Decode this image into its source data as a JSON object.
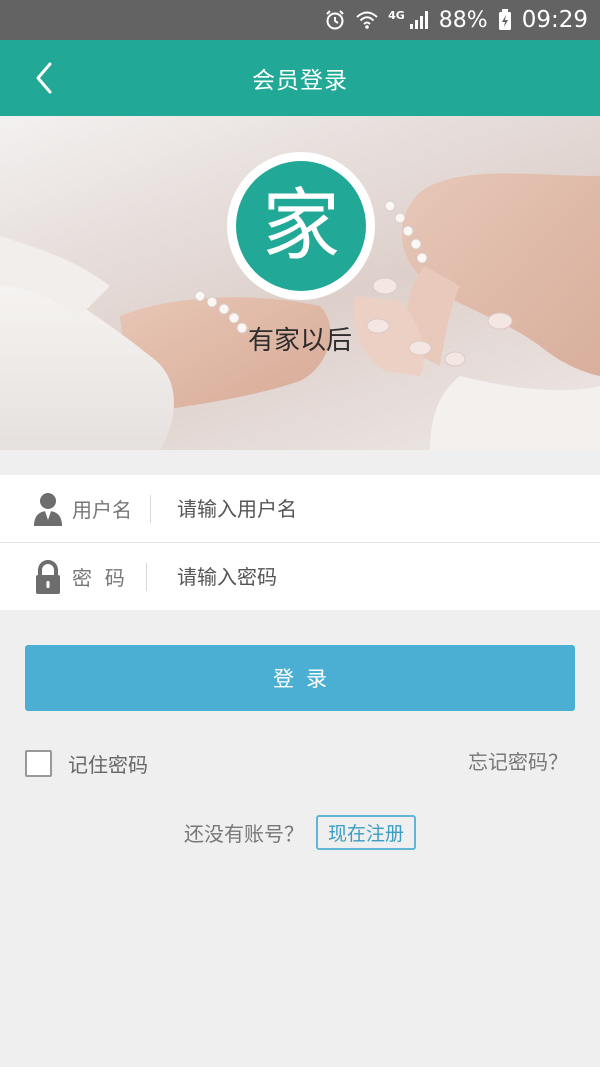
{
  "status_bar": {
    "network": "4G",
    "battery": "88%",
    "time": "09:29",
    "icons": [
      "alarm-icon",
      "wifi-icon",
      "signal-icon",
      "battery-charging-icon"
    ]
  },
  "header": {
    "title": "会员登录",
    "back_icon": "chevron-left-icon"
  },
  "banner": {
    "logo_char": "家",
    "slogan": "有家以后"
  },
  "form": {
    "username": {
      "label": "用户名",
      "placeholder": "请输入用户名",
      "value": "",
      "icon": "user-icon"
    },
    "password": {
      "label": "密  码",
      "placeholder": "请输入密码",
      "value": "",
      "icon": "lock-icon"
    }
  },
  "login_button": "登录",
  "remember_label": "记住密码",
  "remember_checked": false,
  "forgot_label": "忘记密码？",
  "register": {
    "prompt": "还没有账号？",
    "link": "现在注册"
  },
  "colors": {
    "primary": "#22a896",
    "button": "#4aafd2",
    "background": "#efefef"
  }
}
